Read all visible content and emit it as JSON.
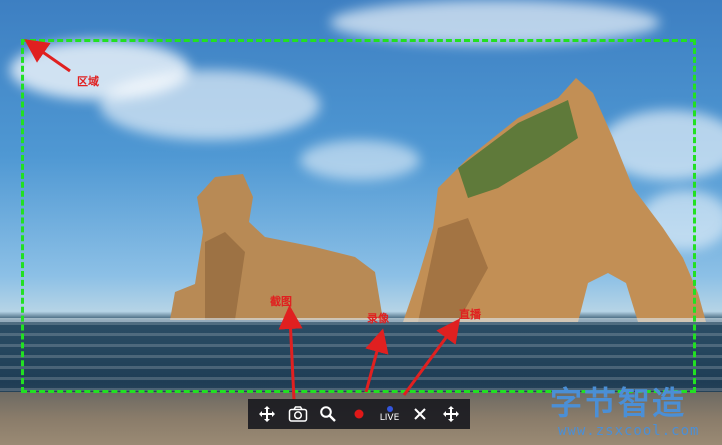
{
  "annotations": {
    "region": "区域",
    "screenshot": "截图",
    "record": "录像",
    "live": "直播"
  },
  "toolbar": {
    "buttons": [
      {
        "icon": "move-icon"
      },
      {
        "icon": "camera-icon"
      },
      {
        "icon": "zoom-icon"
      },
      {
        "icon": "record-dot-icon"
      },
      {
        "icon": "live-icon",
        "label": "LIVE"
      },
      {
        "icon": "close-icon"
      },
      {
        "icon": "move-icon"
      }
    ]
  },
  "watermark": {
    "title": "字节智造",
    "url": "www.zsxcool.com"
  },
  "colors": {
    "selection_border": "#22e022",
    "annotation": "#e02020",
    "record_dot": "#e01818",
    "live_dot": "#3355dd",
    "watermark": "#4b8fd6"
  }
}
